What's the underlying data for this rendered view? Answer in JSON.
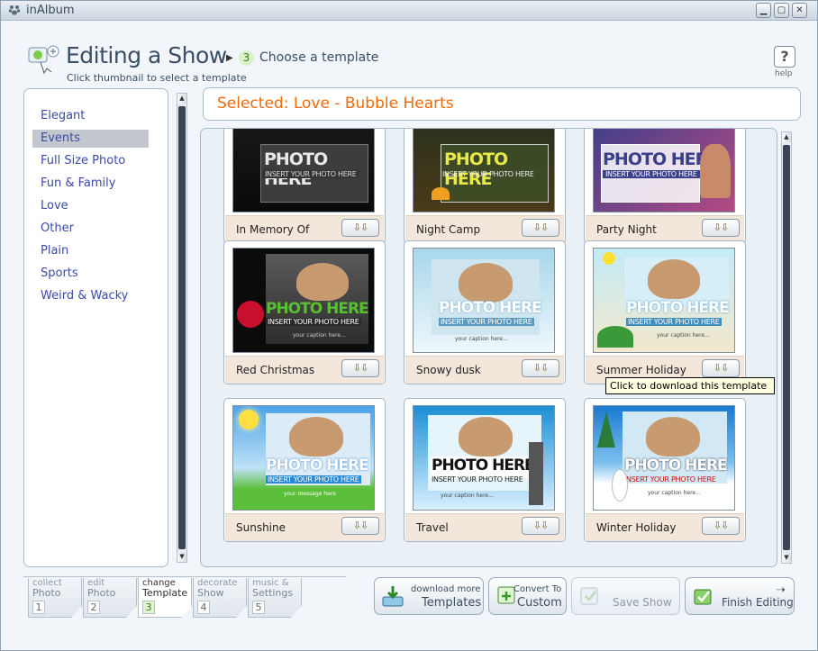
{
  "window": {
    "title": "inAlbum"
  },
  "header": {
    "title": "Editing a Show",
    "step_number": "3",
    "step_label": "Choose a template",
    "subtitle": "Click thumbnail to select a template",
    "help_label": "help",
    "help_glyph": "?"
  },
  "categories": [
    "Elegant",
    "Events",
    "Full Size Photo",
    "Fun & Family",
    "Love",
    "Other",
    "Plain",
    "Sports",
    "Weird & Wacky"
  ],
  "selected_category": "Events",
  "selected_banner": "Selected: Love - Bubble Hearts",
  "placeholder": {
    "title": "PHOTO HERE",
    "subtitle": "INSERT YOUR PHOTO HERE",
    "caption": "your caption here...",
    "message": "your message here"
  },
  "download_glyph": "⇩⇩",
  "templates": [
    {
      "name": "In Memory Of",
      "colors": [
        "#111111",
        "#2c2c2c"
      ]
    },
    {
      "name": "Night Camp",
      "colors": [
        "#2a2416",
        "#6b5a2a"
      ]
    },
    {
      "name": "Party Night",
      "colors": [
        "#3a3f8a",
        "#b44a84"
      ]
    },
    {
      "name": "Red Christmas",
      "colors": [
        "#0a0a0a",
        "#3a3a3a"
      ]
    },
    {
      "name": "Snowy dusk",
      "colors": [
        "#9fd0e6",
        "#eaf6fb"
      ]
    },
    {
      "name": "Summer Holiday",
      "colors": [
        "#bfe8f5",
        "#f5e8c9"
      ]
    },
    {
      "name": "Sunshine",
      "colors": [
        "#4aa3e8",
        "#5cbf3a"
      ]
    },
    {
      "name": "Travel",
      "colors": [
        "#1c8fd6",
        "#cfeaff"
      ]
    },
    {
      "name": "Winter Holiday",
      "colors": [
        "#1a7ad0",
        "#ffffff"
      ]
    }
  ],
  "tooltip": "Click to download this template",
  "step_tabs": [
    {
      "line1": "collect",
      "line2": "Photo",
      "num": "1"
    },
    {
      "line1": "edit",
      "line2": "Photo",
      "num": "2"
    },
    {
      "line1": "change",
      "line2": "Template",
      "num": "3"
    },
    {
      "line1": "decorate",
      "line2": "Show",
      "num": "4"
    },
    {
      "line1": "music &",
      "line2": "Settings",
      "num": "5"
    }
  ],
  "buttons": {
    "download_more": {
      "line1": "download more",
      "line2": "Templates"
    },
    "convert": {
      "line1": "Convert To",
      "line2": "Custom"
    },
    "save": "Save Show",
    "finish": "Finish Editing"
  }
}
